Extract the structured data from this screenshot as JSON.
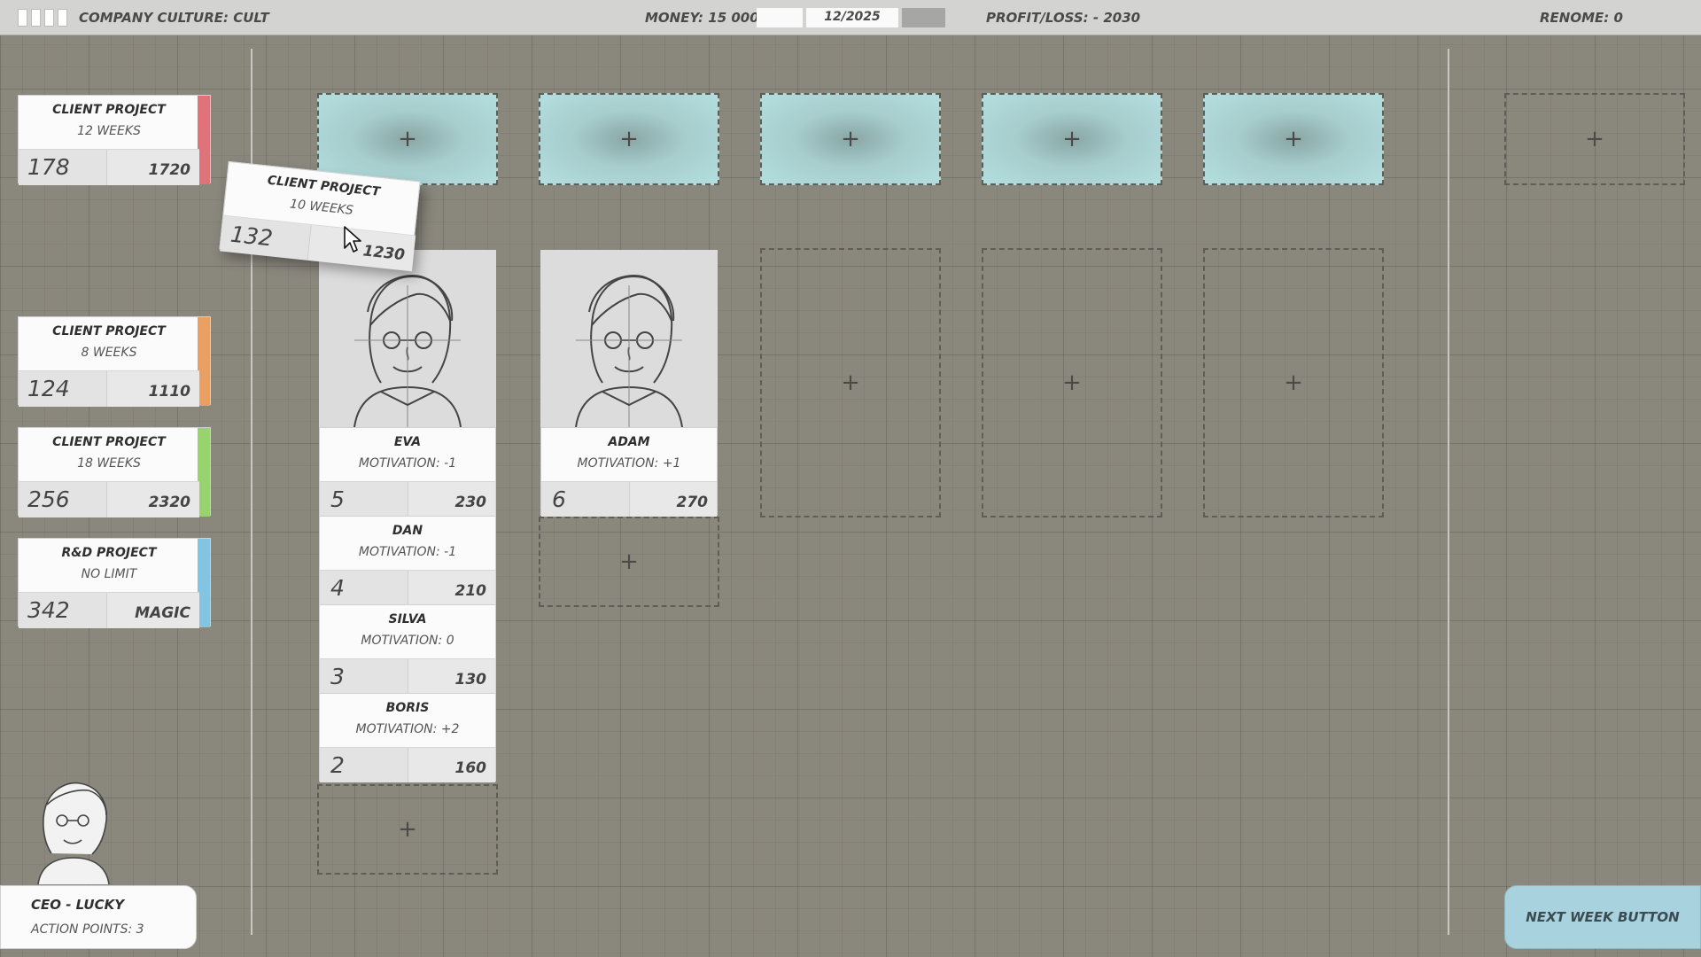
{
  "topbar": {
    "company_culture": "COMPANY CULTURE: CULT",
    "money": "MONEY: 15 000",
    "date": "12/2025",
    "profit_loss": "PROFIT/LOSS: - 2030",
    "renome": "RENOME: 0"
  },
  "projects": [
    {
      "title": "CLIENT PROJECT",
      "duration": "12 WEEKS",
      "work": "178",
      "reward": "1720",
      "color": "#e0727a"
    },
    {
      "title": "CLIENT PROJECT",
      "duration": "8 WEEKS",
      "work": "124",
      "reward": "1110",
      "color": "#eaa063"
    },
    {
      "title": "CLIENT PROJECT",
      "duration": "18 WEEKS",
      "work": "256",
      "reward": "2320",
      "color": "#97d470"
    },
    {
      "title": "R&D PROJECT",
      "duration": "NO LIMIT",
      "work": "342",
      "reward": "MAGIC",
      "color": "#83c4e2"
    }
  ],
  "dragged_project": {
    "title": "CLIENT PROJECT",
    "duration": "10 WEEKS",
    "work": "132",
    "reward": "1230"
  },
  "zone_plus": "+",
  "employees": [
    {
      "name": "EVA",
      "motivation": "MOTIVATION: -1",
      "skill": "5",
      "salary": "230"
    },
    {
      "name": "DAN",
      "motivation": "MOTIVATION: -1",
      "skill": "4",
      "salary": "210"
    },
    {
      "name": "SILVA",
      "motivation": "MOTIVATION: 0",
      "skill": "3",
      "salary": "130"
    },
    {
      "name": "BORIS",
      "motivation": "MOTIVATION: +2",
      "skill": "2",
      "salary": "160"
    },
    {
      "name": "ADAM",
      "motivation": "MOTIVATION: +1",
      "skill": "6",
      "salary": "270"
    }
  ],
  "ceo": {
    "name": "CEO - LUCKY",
    "action_points": "ACTION POINTS: 3"
  },
  "next_week_label": "NEXT WEEK BUTTON",
  "colors": {
    "teal_zone": "#b4dede",
    "board": "#8a877d",
    "button": "#a8d2dd"
  }
}
